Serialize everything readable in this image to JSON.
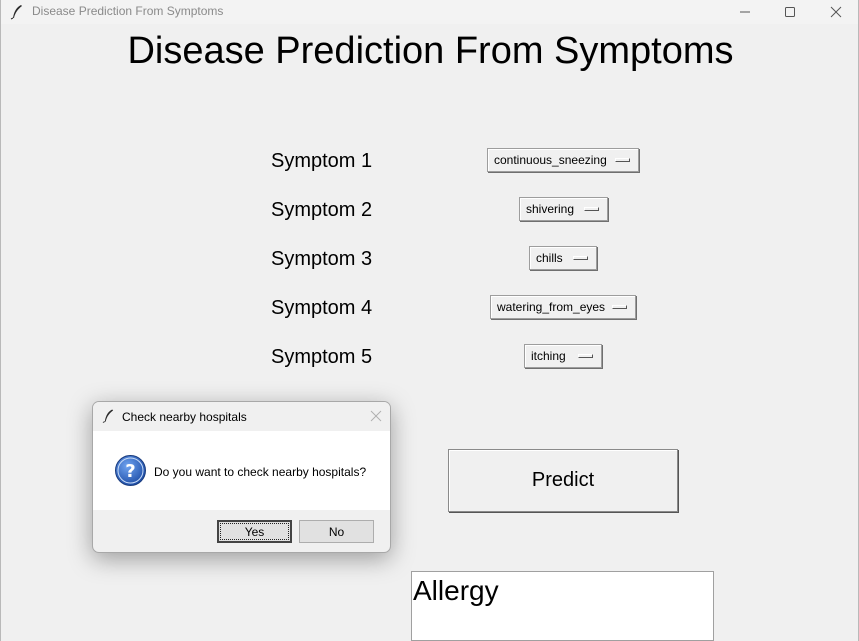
{
  "window": {
    "title": "Disease Prediction From Symptoms",
    "heading": "Disease Prediction From Symptoms"
  },
  "symptoms": [
    {
      "label": "Symptom 1",
      "value": "continuous_sneezing"
    },
    {
      "label": "Symptom 2",
      "value": "shivering"
    },
    {
      "label": "Symptom 3",
      "value": "chills"
    },
    {
      "label": "Symptom 4",
      "value": "watering_from_eyes"
    },
    {
      "label": "Symptom 5",
      "value": "itching"
    }
  ],
  "predict_button": {
    "label": "Predict"
  },
  "result": {
    "text": "Allergy"
  },
  "dialog": {
    "title": "Check nearby hospitals",
    "message": "Do you want to check nearby hospitals?",
    "yes_label": "Yes",
    "no_label": "No"
  },
  "icons": {
    "app": "feather-icon",
    "minimize": "minimize-icon",
    "maximize": "maximize-icon",
    "close": "close-icon",
    "question": "question-icon"
  },
  "colors": {
    "background": "#f0f0f0",
    "question_icon": "#1f4fa8"
  }
}
